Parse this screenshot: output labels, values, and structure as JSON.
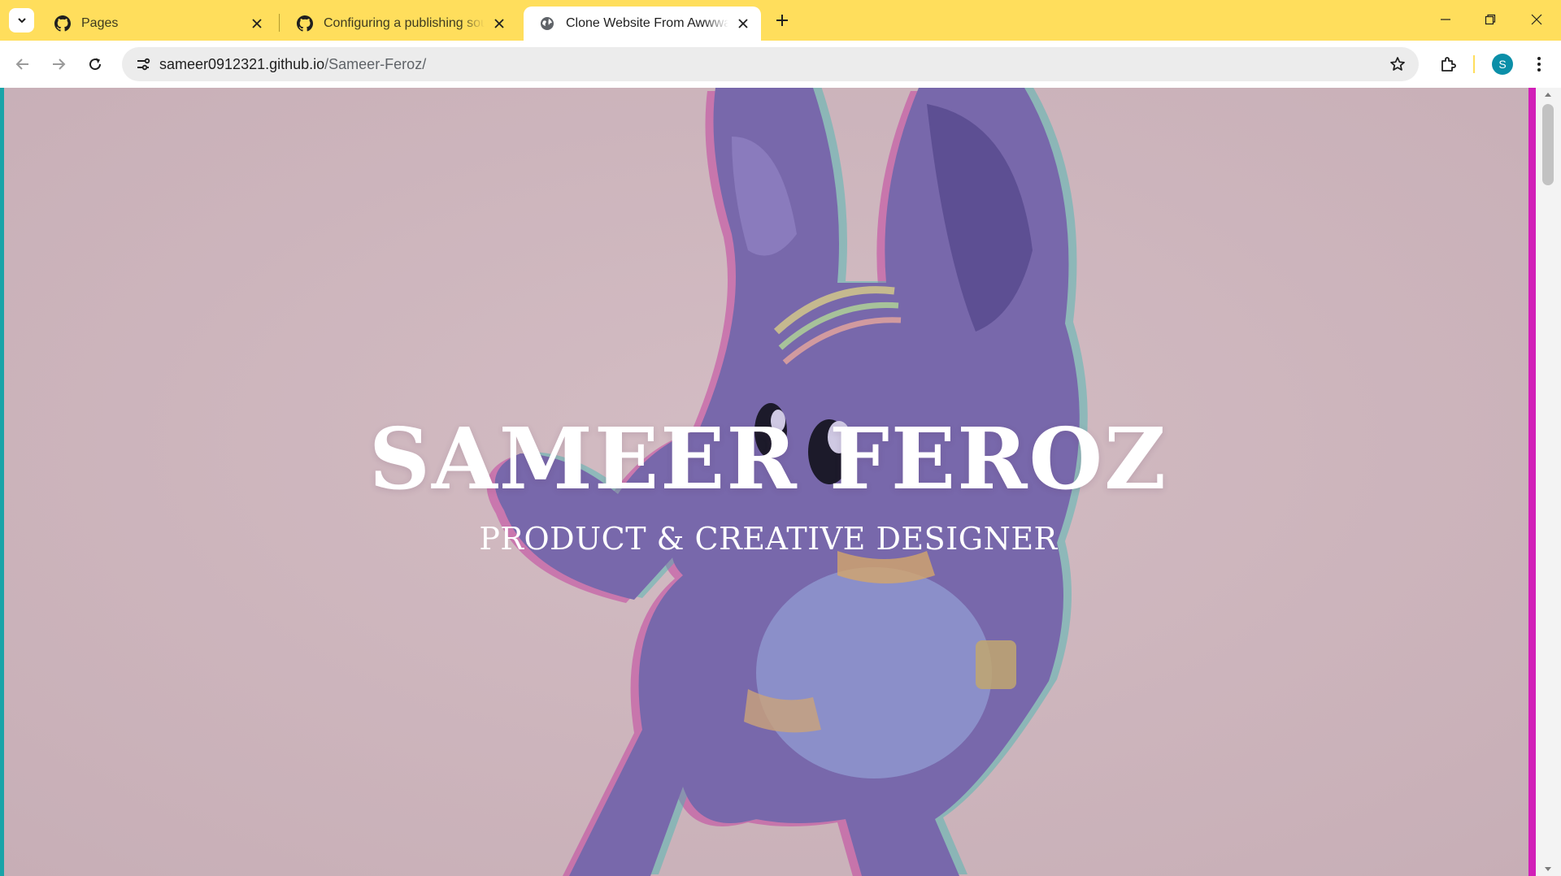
{
  "browser": {
    "tabs": [
      {
        "title": "Pages",
        "favicon": "github-icon",
        "active": false
      },
      {
        "title": "Configuring a publishing source for your GitHub Pages site",
        "favicon": "github-icon",
        "active": false
      },
      {
        "title": "Clone Website From Awwwards",
        "favicon": "globe-icon",
        "active": true
      }
    ],
    "new_tab_symbol": "+",
    "address": {
      "host": "sameer0912321.github.io",
      "path": "/Sameer-Feroz/"
    },
    "profile_initial": "S",
    "colors": {
      "frame": "#ffde5c",
      "avatar": "#0b8fa8"
    }
  },
  "page": {
    "title": "SAMEER FEROZ",
    "subtitle": "PRODUCT & CREATIVE DESIGNER",
    "background_color": "#cdb3bb"
  }
}
